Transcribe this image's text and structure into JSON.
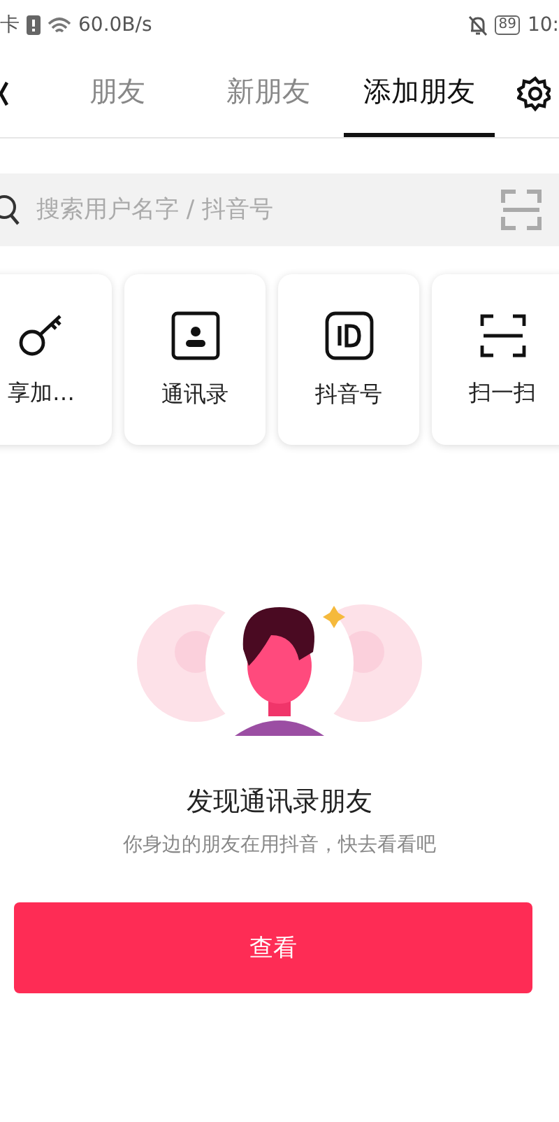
{
  "status_bar": {
    "carrier": "卡",
    "speed": "60.0B/s",
    "battery": "89",
    "time": "10:"
  },
  "tabs": [
    {
      "label": "朋友",
      "selected": false
    },
    {
      "label": "新朋友",
      "selected": false
    },
    {
      "label": "添加朋友",
      "selected": true
    }
  ],
  "search": {
    "placeholder": "搜索用户名字 / 抖音号"
  },
  "actions": [
    {
      "label": "享加…",
      "kind": "share"
    },
    {
      "label": "通讯录",
      "kind": "contacts"
    },
    {
      "label": "抖音号",
      "kind": "id"
    },
    {
      "label": "扫一扫",
      "kind": "scan"
    }
  ],
  "invite": {
    "title": "发现通讯录朋友",
    "subtitle": "你身边的朋友在用抖音，快去看看吧",
    "button": "查看"
  }
}
